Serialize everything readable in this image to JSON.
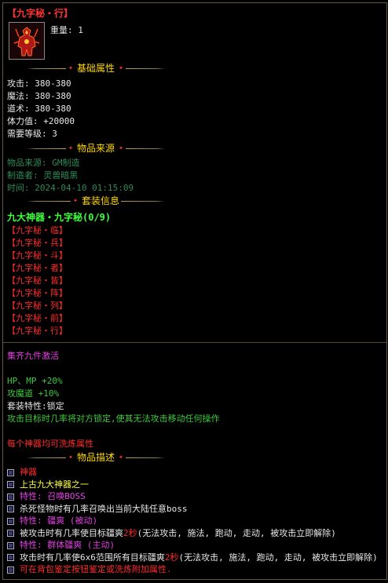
{
  "item": {
    "name": "【九字秘・行】",
    "weight": "重量: 1"
  },
  "sections": {
    "base": "基础属性",
    "source": "物品来源",
    "set": "套装信息",
    "desc": "物品描述"
  },
  "stats": [
    "攻击: 380-380",
    "魔法: 380-380",
    "道术: 380-380",
    "体力值: +20000",
    "需要等级: 3"
  ],
  "source": [
    "物品来源: GM制造",
    "制造者: 灵兽暗黑",
    "时间: 2024-04-10 01:15:09"
  ],
  "set": {
    "name": "九大神器・九字秘(0/9)",
    "items": [
      "【九字秘・临】",
      "【九字秘・兵】",
      "【九字秘・斗】",
      "【九字秘・者】",
      "【九字秘・皆】",
      "【九字秘・阵】",
      "【九字秘・列】",
      "【九字秘・前】",
      "【九字秘・行】"
    ],
    "activate": "集齐九件激活",
    "bonus1": "HP、MP +20%",
    "bonus2": "攻魔道 +10%",
    "feature": "套装特性:锁定",
    "feature_desc": "攻击目标时几率将对方锁定,使其无法攻击移动任何操作",
    "refine_note": "每个神器均可洗炼属性"
  },
  "desc": {
    "l1": "神器",
    "l2": "上古九大神器之一",
    "l3": "特性: 召唤BOSS",
    "l4": "杀死怪物时有几率召唤出当前大陆任意boss",
    "l5": "特性: 疆爽 (被动)",
    "l6a": "被攻击时有几率使目标疆爽",
    "l6b": "2秒",
    "l6c": " (无法攻击, 施法, 跑动, 走动, 被攻击立即解除)",
    "l7": "特性: 群体疆爽 (主动)",
    "l8a": "攻击时有几率使6x6范围所有目标疆爽",
    "l8b": "2秒",
    "l8c": " (无法攻击, 施法, 跑动, 走动, 被攻击立即解除)",
    "l9": "可在背包鉴定按钮鉴定或洗炼附加属性."
  },
  "colors": {
    "name": "#ff3333",
    "section_title": "#ffd700",
    "set_name": "#3cff3c",
    "set_item": "#ff2a2a",
    "source": "#2e8b57",
    "magenta": "#e040e0"
  }
}
